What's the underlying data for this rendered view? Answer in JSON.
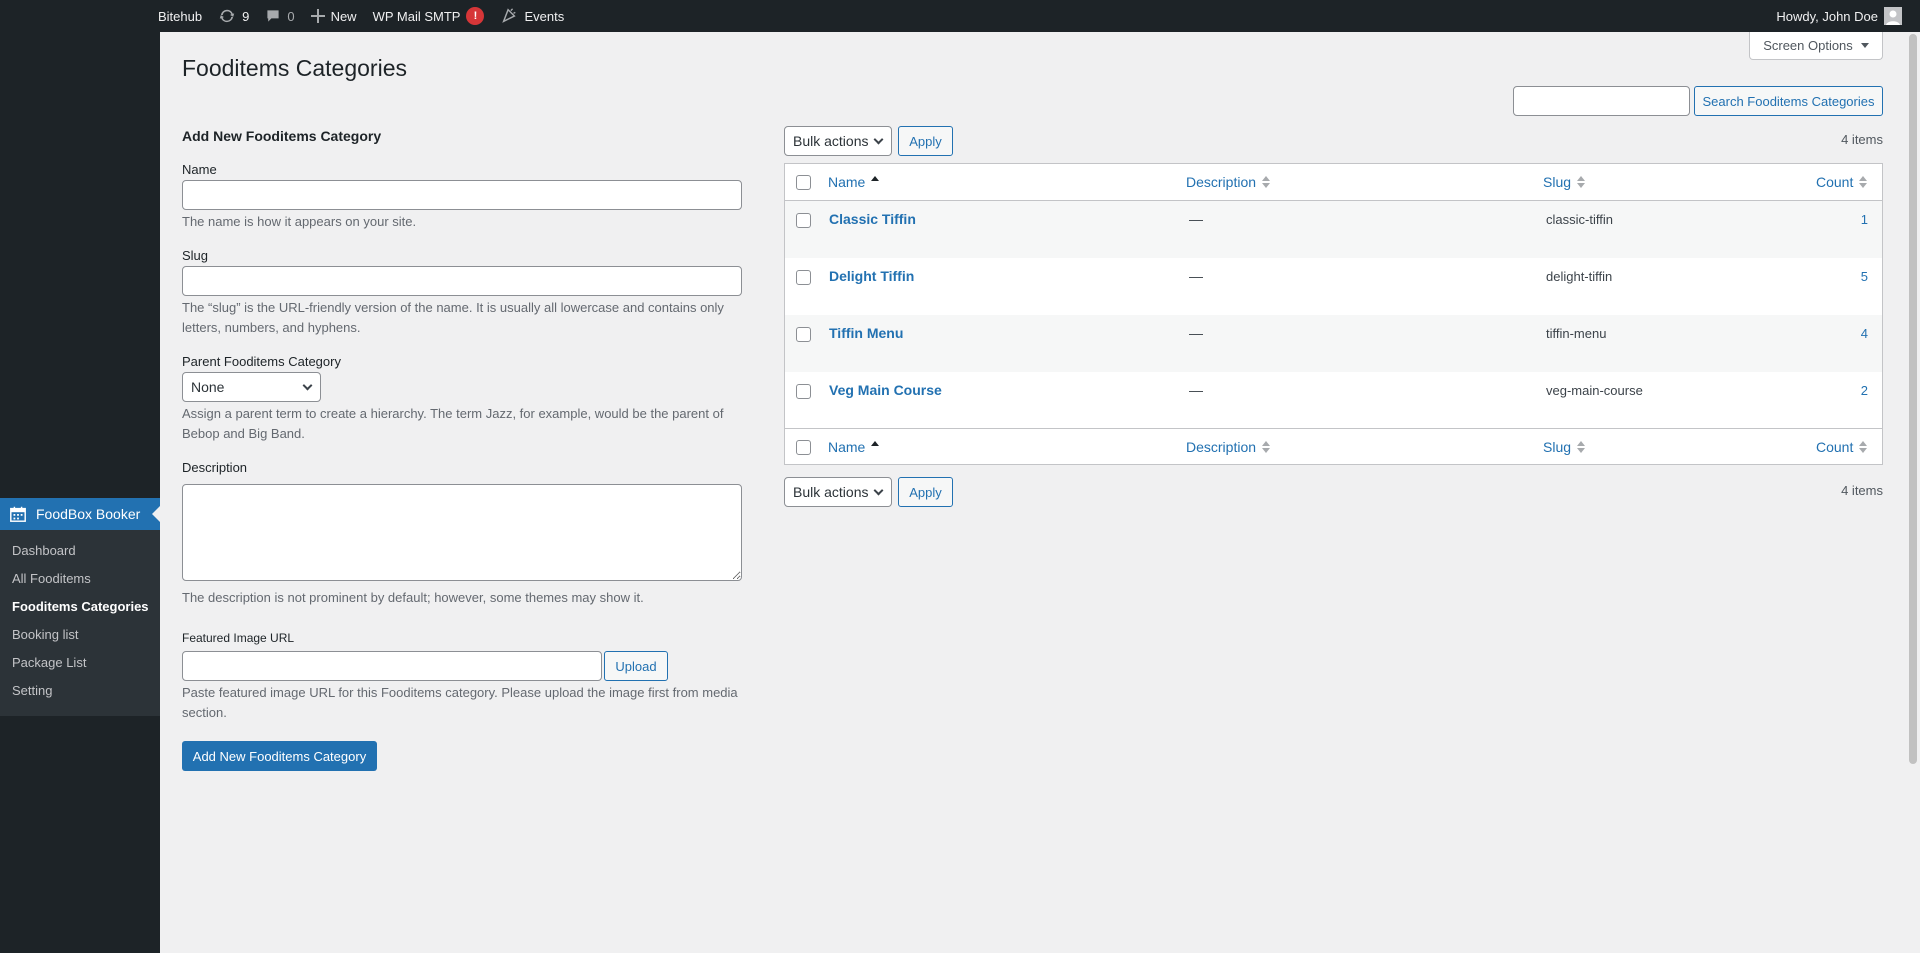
{
  "adminbar": {
    "site": "Bitehub",
    "updates_count": "9",
    "comments_count": "0",
    "new_label": "New",
    "smtp_label": "WP Mail SMTP",
    "smtp_badge": "!",
    "events_label": "Events",
    "greeting": "Howdy, John Doe"
  },
  "sidebar": {
    "plugin_label": "FoodBox Booker",
    "items": [
      {
        "label": "Dashboard"
      },
      {
        "label": "All Fooditems"
      },
      {
        "label": "Fooditems Categories"
      },
      {
        "label": "Booking list"
      },
      {
        "label": "Package List"
      },
      {
        "label": "Setting"
      }
    ]
  },
  "header": {
    "title": "Fooditems Categories",
    "screen_options": "Screen Options"
  },
  "search": {
    "button_label": "Search Fooditems Categories",
    "value": ""
  },
  "form": {
    "title": "Add New Fooditems Category",
    "name_label": "Name",
    "name_value": "",
    "name_help": "The name is how it appears on your site.",
    "slug_label": "Slug",
    "slug_value": "",
    "slug_help": "The “slug” is the URL-friendly version of the name. It is usually all lowercase and contains only letters, numbers, and hyphens.",
    "parent_label": "Parent Fooditems Category",
    "parent_value": "None",
    "parent_help": "Assign a parent term to create a hierarchy. The term Jazz, for example, would be the parent of Bebop and Big Band.",
    "description_label": "Description",
    "description_value": "",
    "description_help": "The description is not prominent by default; however, some themes may show it.",
    "image_label": "Featured Image URL",
    "image_value": "",
    "upload_label": "Upload",
    "image_help": "Paste featured image URL for this Fooditems category. Please upload the image first from media section.",
    "submit_label": "Add New Fooditems Category"
  },
  "table": {
    "bulk_label": "Bulk actions",
    "apply_label": "Apply",
    "items_count": "4 items",
    "columns": {
      "name": "Name",
      "description": "Description",
      "slug": "Slug",
      "count": "Count"
    },
    "rows": [
      {
        "name": "Classic Tiffin",
        "description": "—",
        "slug": "classic-tiffin",
        "count": "1"
      },
      {
        "name": "Delight Tiffin",
        "description": "—",
        "slug": "delight-tiffin",
        "count": "5"
      },
      {
        "name": "Tiffin Menu",
        "description": "—",
        "slug": "tiffin-menu",
        "count": "4"
      },
      {
        "name": "Veg Main Course",
        "description": "—",
        "slug": "veg-main-course",
        "count": "2"
      }
    ]
  },
  "colors": {
    "accent": "#2271b1",
    "adminbar_bg": "#1d2327",
    "badge": "#d63638"
  }
}
